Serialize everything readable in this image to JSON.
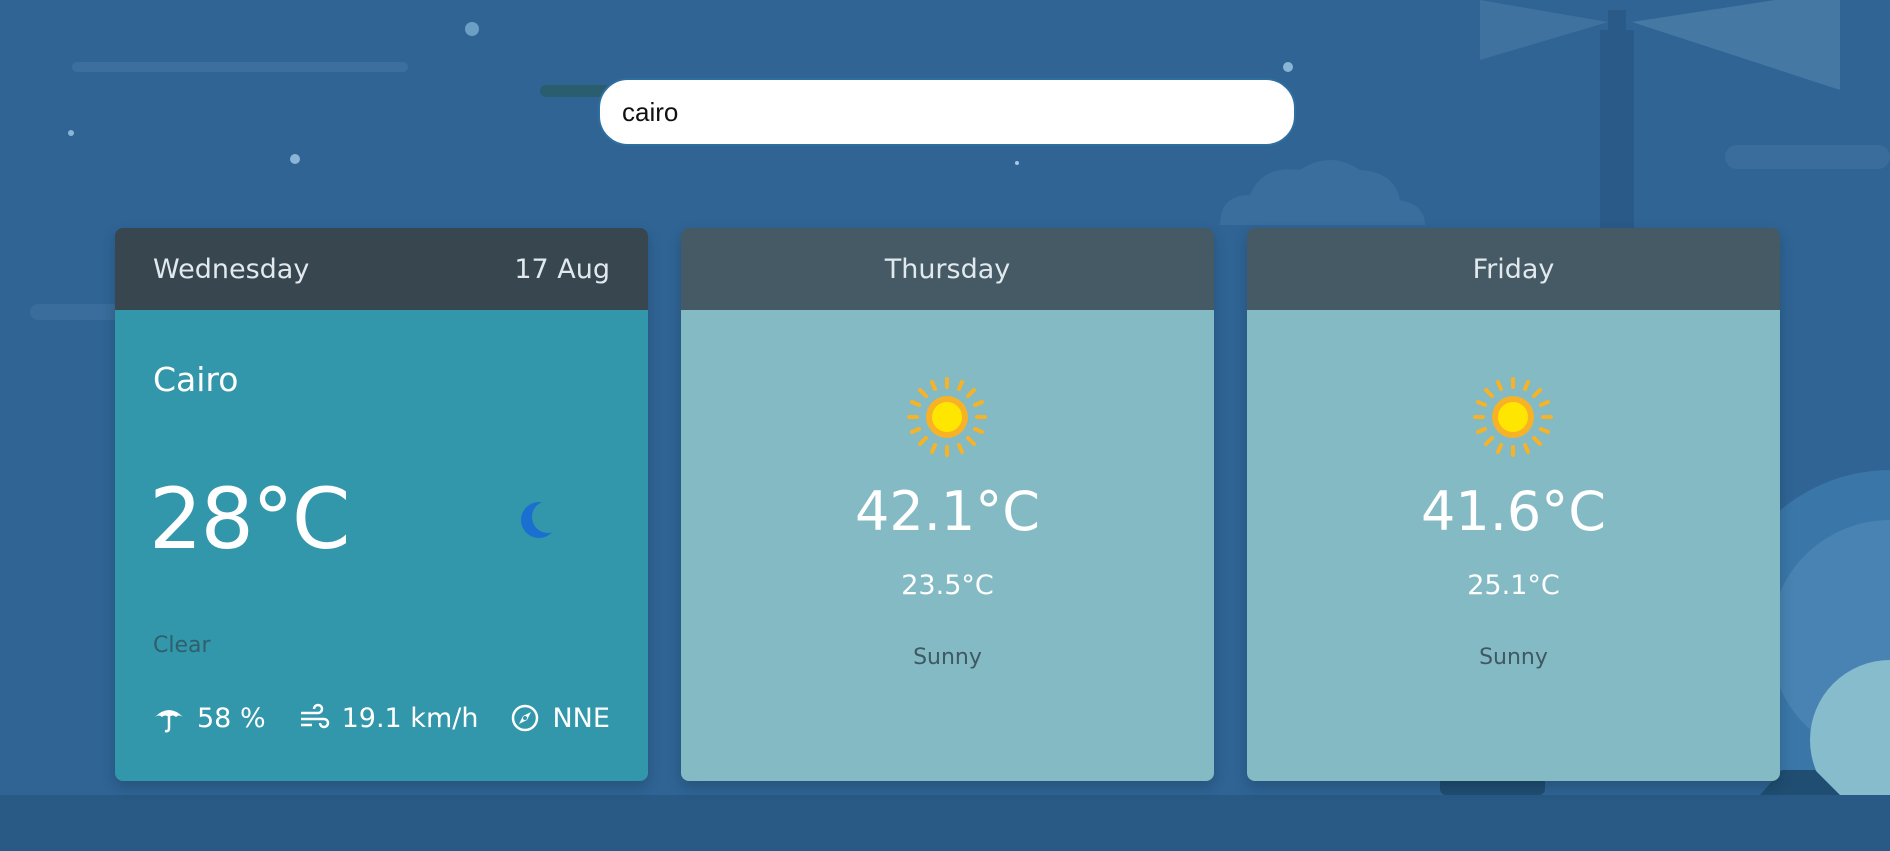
{
  "search": {
    "value": "cairo"
  },
  "today": {
    "day": "Wednesday",
    "date": "17 Aug",
    "city": "Cairo",
    "temperature": "28°C",
    "condition": "Clear",
    "condition_icon": "moon-icon",
    "humidity": "58 %",
    "wind_speed": "19.1 km/h",
    "wind_direction": "NNE"
  },
  "forecast": [
    {
      "day": "Thursday",
      "max": "42.1°C",
      "min": "23.5°C",
      "condition": "Sunny",
      "icon": "sun-icon"
    },
    {
      "day": "Friday",
      "max": "41.6°C",
      "min": "25.1°C",
      "condition": "Sunny",
      "icon": "sun-icon"
    }
  ],
  "colors": {
    "background": "#2f6495",
    "today_header": "#38474f",
    "today_body": "#3297ab",
    "forecast_header": "#465a65",
    "forecast_body": "#84bac4",
    "sun": "#f7c21a"
  }
}
